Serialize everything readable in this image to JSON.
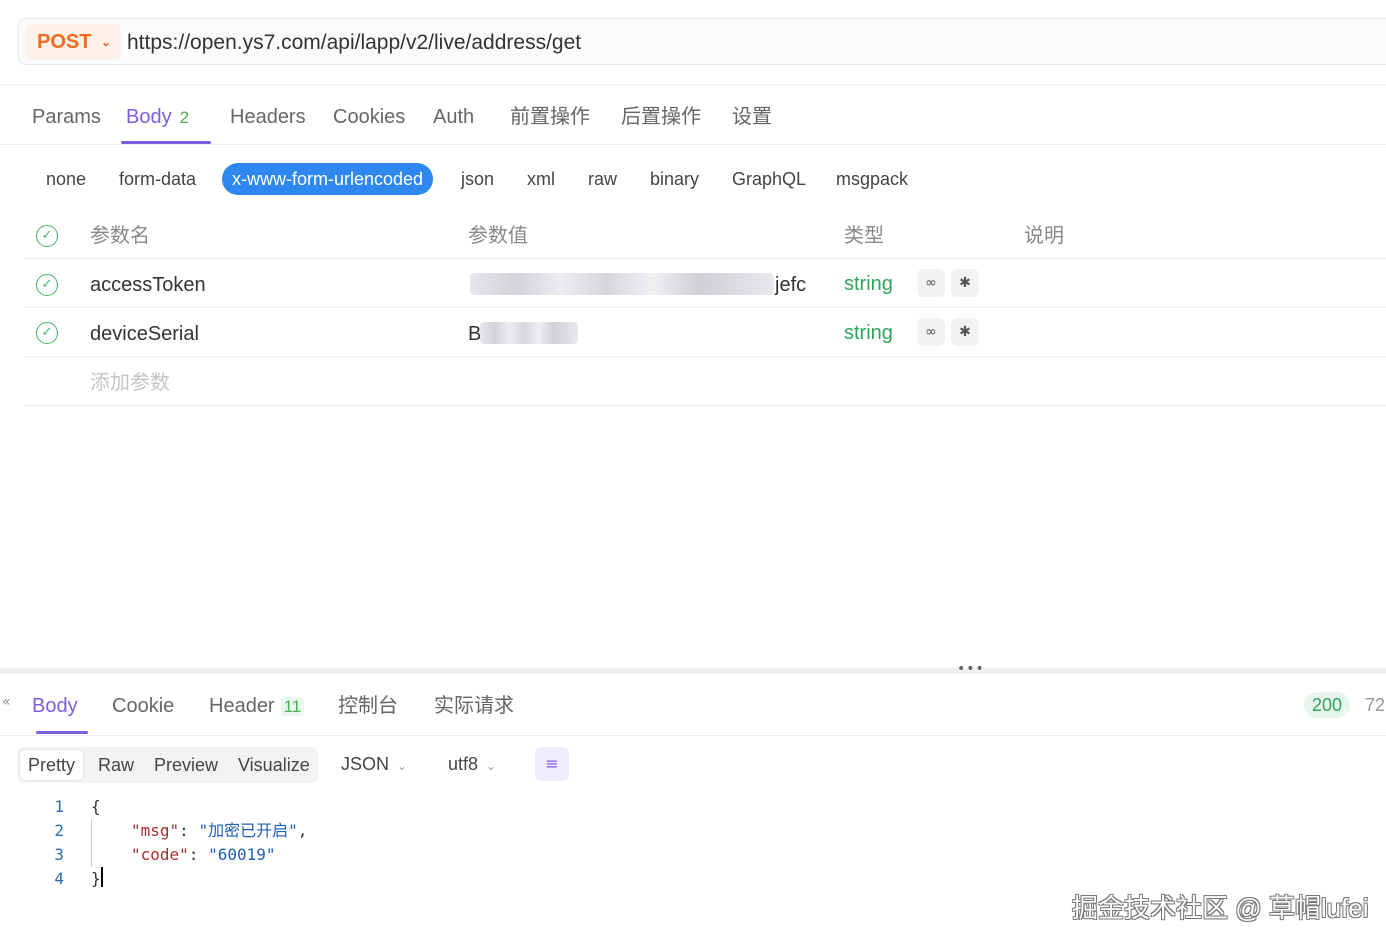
{
  "request": {
    "method": "POST",
    "url": "https://open.ys7.com/api/lapp/v2/live/address/get"
  },
  "request_tabs": [
    {
      "label": "Params",
      "count": ""
    },
    {
      "label": "Body",
      "count": "2"
    },
    {
      "label": "Headers",
      "count": ""
    },
    {
      "label": "Cookies",
      "count": ""
    },
    {
      "label": "Auth",
      "count": ""
    },
    {
      "label": "前置操作",
      "count": ""
    },
    {
      "label": "后置操作",
      "count": ""
    },
    {
      "label": "设置",
      "count": ""
    }
  ],
  "body_types": [
    "none",
    "form-data",
    "x-www-form-urlencoded",
    "json",
    "xml",
    "raw",
    "binary",
    "GraphQL",
    "msgpack"
  ],
  "body_type_selected": "x-www-form-urlencoded",
  "params_table": {
    "headers": {
      "name": "参数名",
      "value": "参数值",
      "type": "类型",
      "desc": "说明"
    },
    "rows": [
      {
        "name": "accessToken",
        "value_visible": "jefc",
        "type": "string"
      },
      {
        "name": "deviceSerial",
        "value_visible": "B",
        "type": "string"
      }
    ],
    "add_placeholder": "添加参数"
  },
  "response_tabs": [
    {
      "label": "Body",
      "count": ""
    },
    {
      "label": "Cookie",
      "count": ""
    },
    {
      "label": "Header",
      "count": "11"
    },
    {
      "label": "控制台",
      "count": ""
    },
    {
      "label": "实际请求",
      "count": ""
    }
  ],
  "response_status": "200",
  "response_size": "72",
  "view_modes": [
    "Pretty",
    "Raw",
    "Preview",
    "Visualize"
  ],
  "view_mode_selected": "Pretty",
  "format": "JSON",
  "encoding": "utf8",
  "code": {
    "line_numbers": [
      "1",
      "2",
      "3",
      "4"
    ],
    "open_brace": "{",
    "close_brace": "}",
    "msg_key": "\"msg\"",
    "msg_value": "\"加密已开启\"",
    "code_key": "\"code\"",
    "code_value": "\"60019\""
  },
  "watermark": "掘金技术社区 @ 草帽lufei",
  "colors": {
    "accent": "#7b5fe0",
    "method": "#f06a22",
    "selected_body_type": "#2f88f0",
    "success": "#2ea55a"
  }
}
